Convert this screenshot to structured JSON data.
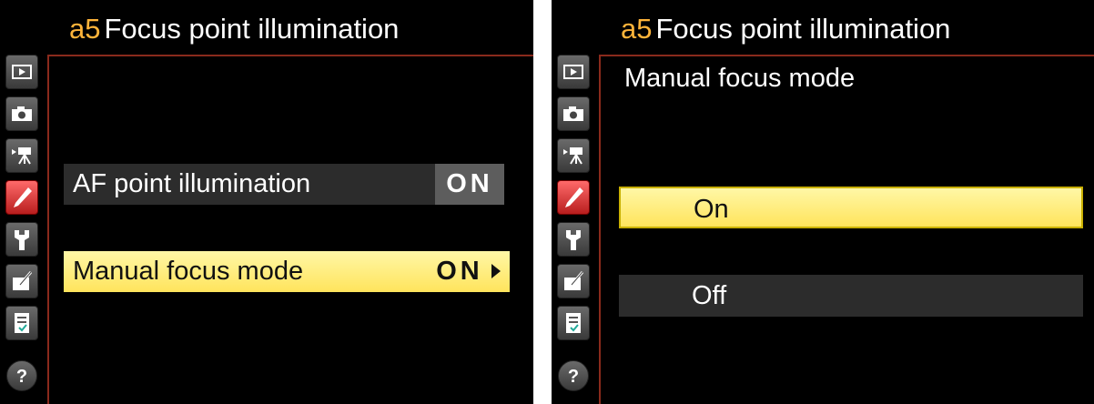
{
  "left_screen": {
    "title_code": "a5",
    "title": "Focus point illumination",
    "menu": [
      {
        "label": "AF point illumination",
        "value": "ON",
        "selected": false
      },
      {
        "label": "Manual focus mode",
        "value": "ON",
        "selected": true
      }
    ]
  },
  "right_screen": {
    "title_code": "a5",
    "title": "Focus point illumination",
    "subtitle": "Manual focus mode",
    "options": [
      {
        "label": "On",
        "selected": true
      },
      {
        "label": "Off",
        "selected": false
      }
    ]
  },
  "rail_icons": [
    "playback-icon",
    "camera-icon",
    "movie-icon",
    "pencil-icon",
    "wrench-icon",
    "retouch-icon",
    "my-menu-icon",
    "help-icon"
  ],
  "colors": {
    "highlight": "#ffe45c",
    "accent_active": "#d42a2a",
    "title_code": "#ffb43a",
    "divider": "#8a2a1c"
  }
}
